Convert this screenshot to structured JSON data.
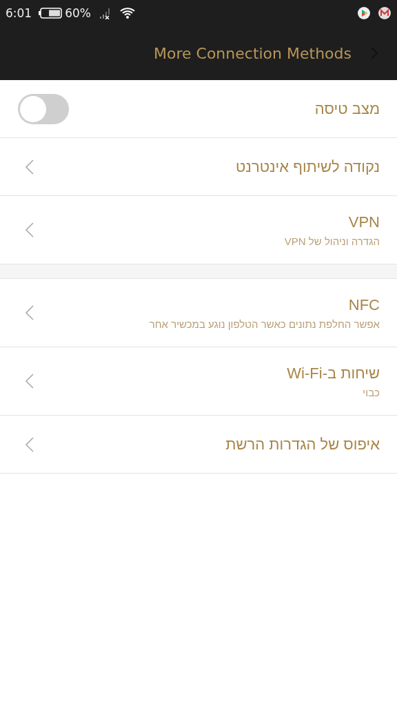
{
  "status_bar": {
    "time": "6:01",
    "battery_text": "60%"
  },
  "header": {
    "title": "More Connection Methods"
  },
  "groups": [
    {
      "items": [
        {
          "kind": "toggle",
          "title": "מצב טיסה",
          "on": false
        },
        {
          "kind": "link",
          "title": "נקודה לשיתוף אינטרנט"
        },
        {
          "kind": "link",
          "title": "VPN",
          "subtitle": "הגדרה וניהול של VPN"
        }
      ]
    },
    {
      "items": [
        {
          "kind": "link",
          "title": "NFC",
          "subtitle": "אפשר החלפת נתונים כאשר הטלפון נוגע במכשיר אחר"
        },
        {
          "kind": "link",
          "title": "שיחות ב-Wi-Fi",
          "subtitle": "כבוי"
        },
        {
          "kind": "link",
          "title": "איפוס של הגדרות הרשת"
        }
      ]
    }
  ]
}
